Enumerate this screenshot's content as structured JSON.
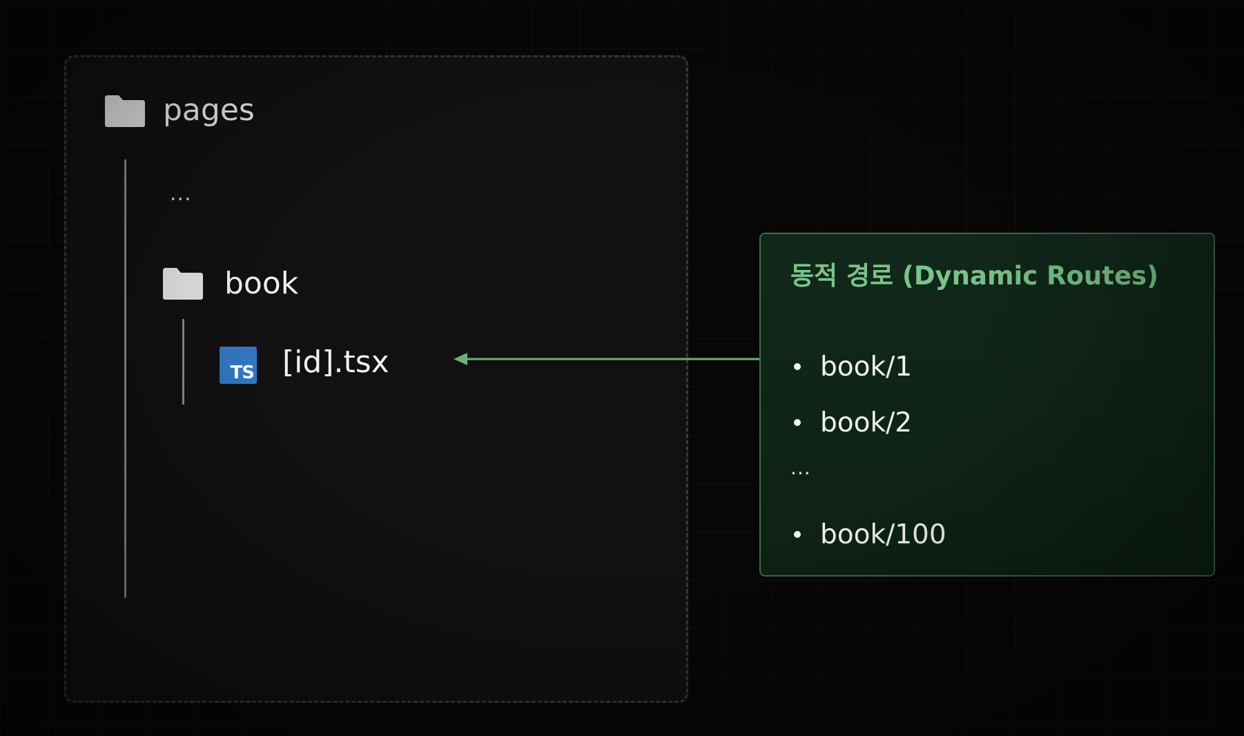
{
  "tree": {
    "root_label": "pages",
    "ellipsis": "...",
    "folder_label": "book",
    "file_badge": "TS",
    "file_label": "[id].tsx"
  },
  "info_box": {
    "title": "동적 경로 (Dynamic Routes)",
    "items": [
      "book/1",
      "book/2",
      "book/100"
    ],
    "ellipsis": "..."
  },
  "colors": {
    "background": "#070707",
    "panel": "#111111",
    "accent_green": "#7ac48a",
    "box_border": "#3d6f45",
    "ts_blue": "#3178c6"
  },
  "icons": [
    "folder-icon",
    "folder-icon",
    "typescript-file-icon",
    "arrow-left-icon"
  ]
}
